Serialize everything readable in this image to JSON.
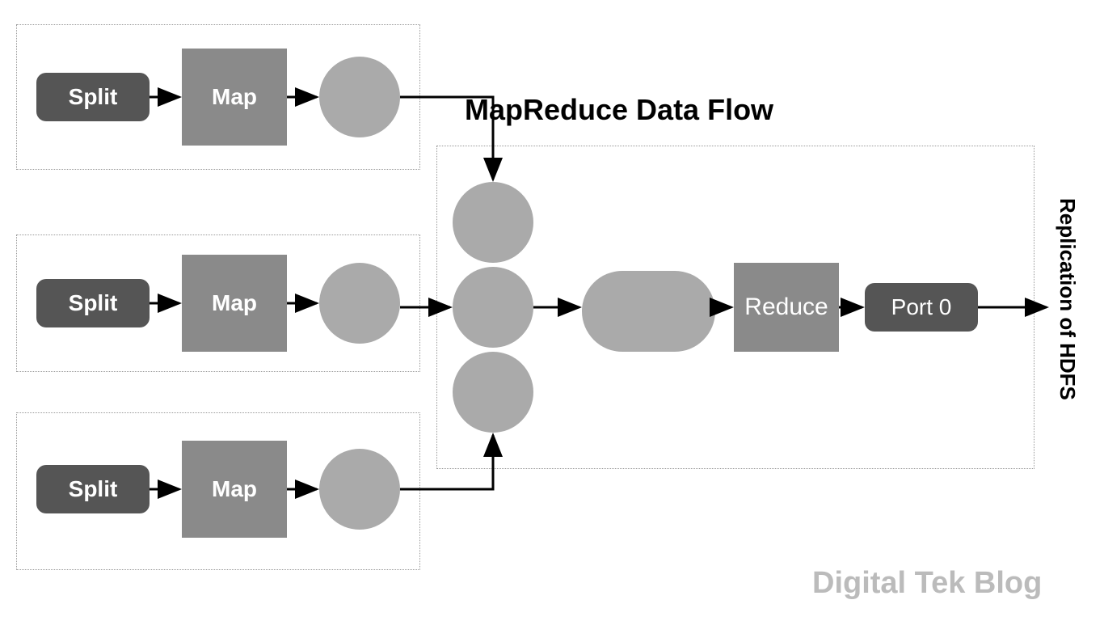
{
  "title": "MapReduce Data Flow",
  "vertical_label": "Replication of HDFS",
  "watermark": "Digital Tek Blog",
  "mappers": [
    {
      "split": "Split",
      "map": "Map"
    },
    {
      "split": "Split",
      "map": "Map"
    },
    {
      "split": "Split",
      "map": "Map"
    }
  ],
  "reduce_label": "Reduce",
  "port_label": "Port 0"
}
